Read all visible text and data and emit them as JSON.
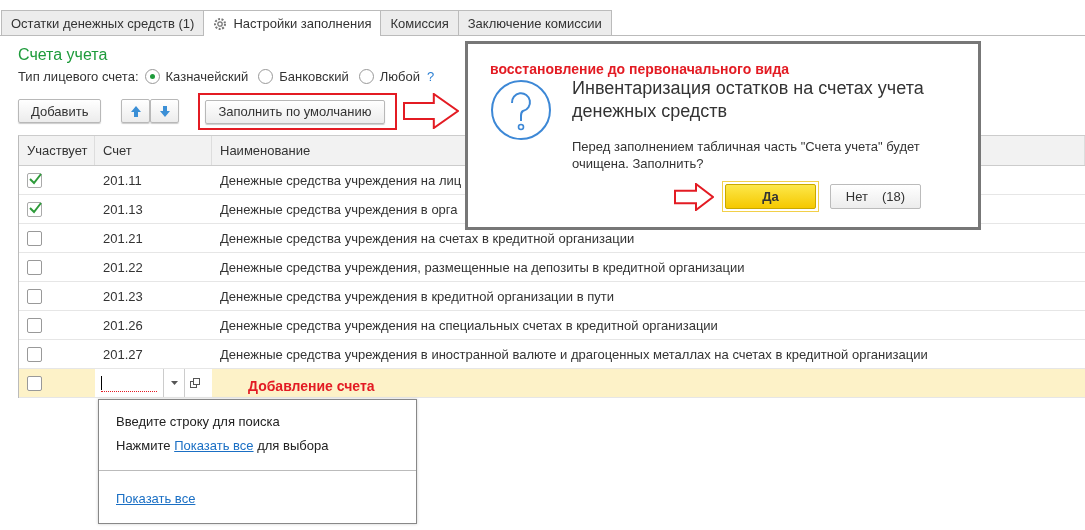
{
  "tabs": [
    {
      "label": "Остатки денежных средств (1)",
      "selected": false
    },
    {
      "label": "Настройки заполнения",
      "selected": true
    },
    {
      "label": "Комиссия",
      "selected": false
    },
    {
      "label": "Заключение комиссии",
      "selected": false
    }
  ],
  "section_title": "Счета учета",
  "account_type": {
    "label": "Тип лицевого счета:",
    "options": [
      {
        "label": "Казначейский",
        "selected": true
      },
      {
        "label": "Банковский",
        "selected": false
      },
      {
        "label": "Любой",
        "selected": false
      }
    ],
    "help": "?"
  },
  "toolbar": {
    "add_button": "Добавить",
    "fill_button": "Заполнить по умолчанию",
    "fill_highlighted": true
  },
  "table": {
    "columns": [
      "Участвует",
      "Счет",
      "Наименование"
    ],
    "rows": [
      {
        "checked": true,
        "account": "201.11",
        "name": "Денежные средства учреждения на лиц"
      },
      {
        "checked": true,
        "account": "201.13",
        "name": "Денежные средства учреждения в орга"
      },
      {
        "checked": false,
        "account": "201.21",
        "name": "Денежные средства учреждения на счетах в кредитной организации"
      },
      {
        "checked": false,
        "account": "201.22",
        "name": "Денежные средства учреждения, размещенные на депозиты в кредитной организации"
      },
      {
        "checked": false,
        "account": "201.23",
        "name": "Денежные средства учреждения в кредитной организации в пути"
      },
      {
        "checked": false,
        "account": "201.26",
        "name": "Денежные средства учреждения на специальных счетах в кредитной организации"
      },
      {
        "checked": false,
        "account": "201.27",
        "name": "Денежные средства учреждения в иностранной валюте и драгоценных металлах на счетах в кредитной организации"
      }
    ],
    "new_row": {
      "checked": false,
      "annotation": "Добавление счета"
    }
  },
  "dropdown": {
    "hint": "Введите строку для поиска",
    "line_before": "Нажмите ",
    "link": "Показать все",
    "line_after": " для выбора",
    "footer_link": "Показать все"
  },
  "dialog": {
    "annotation": "восстановление до первоначального вида",
    "title": "Инвентаризация остатков на счетах учета денежных средств",
    "message": "Перед заполнением табличная часть \"Счета учета\" будет очищена. Заполнить?",
    "buttons": [
      {
        "label": "Да",
        "default": true,
        "pointed": true
      },
      {
        "label": "Нет",
        "default": false,
        "pointed": false,
        "countdown": "(18)"
      }
    ]
  }
}
